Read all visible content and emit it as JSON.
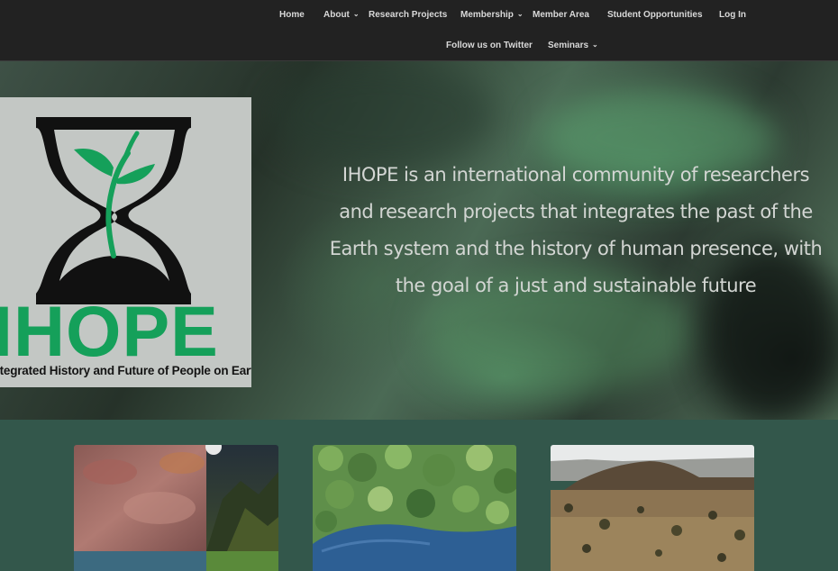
{
  "nav": {
    "row1": [
      {
        "label": "Home",
        "has_dropdown": false
      },
      {
        "label": "About",
        "has_dropdown": true
      },
      {
        "label": "Research Projects",
        "has_dropdown": false
      },
      {
        "label": "Membership",
        "has_dropdown": true
      },
      {
        "label": "Member Area",
        "has_dropdown": false
      },
      {
        "label": "Student Opportunities",
        "has_dropdown": false
      },
      {
        "label": "Log In",
        "has_dropdown": false
      }
    ],
    "row2": [
      {
        "label": "Follow us on Twitter",
        "has_dropdown": false
      },
      {
        "label": "Seminars",
        "has_dropdown": true
      }
    ]
  },
  "hero": {
    "logo": {
      "wordmark": "IHOPE",
      "tagline": "Integrated History and Future of People on Earth",
      "colors": {
        "green": "#15a05a",
        "black": "#141414",
        "card": "#c3c7c4"
      }
    },
    "statement": "IHOPE is an international community of researchers and research projects that integrates the past of the Earth system and the history of human presence, with the goal of a just and sustainable future"
  },
  "cards": [
    {
      "image": "rock-art-and-mountains-collage"
    },
    {
      "image": "aerial-forest-lake"
    },
    {
      "image": "savanna-landscape-hill"
    }
  ],
  "colors": {
    "nav_bg": "#222222",
    "page_bg": "#33574b",
    "nav_text": "#d9d9d9",
    "hero_text": "#d3d6d3"
  }
}
